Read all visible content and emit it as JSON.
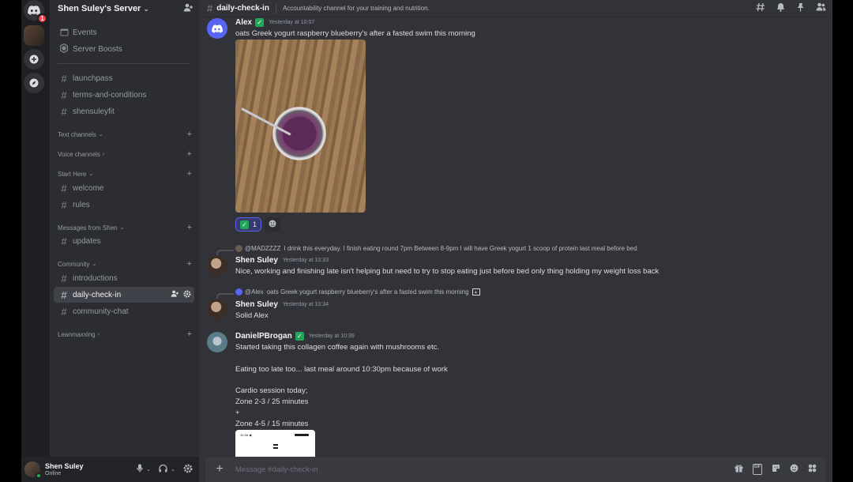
{
  "server": {
    "name": "Shen Suley's Server",
    "home_badge": "1"
  },
  "sidebar": {
    "top_items": [
      {
        "label": "Events",
        "icon": "calendar-icon"
      },
      {
        "label": "Server Boosts",
        "icon": "boost-icon"
      }
    ],
    "pinned_channels": [
      "launchpass",
      "terms-and-conditions",
      "shensuleyfit"
    ],
    "categories": {
      "text": "Text channels",
      "voice": "Voice channels",
      "start_here": "Start Here",
      "messages_from_shen": "Messages from Shen",
      "community": "Community",
      "leanmaxxing": "Leanmaxxing"
    },
    "start_here_channels": [
      "welcome",
      "rules"
    ],
    "shen_channels": [
      "updates"
    ],
    "community_channels": [
      "introductions",
      "daily-check-in",
      "community-chat"
    ],
    "active_channel": "daily-check-in"
  },
  "user": {
    "name": "Shen Suley",
    "status": "Online"
  },
  "channel": {
    "name": "daily-check-in",
    "topic": "Accountability channel for your training and nutrition.",
    "composer_placeholder": "Message #daily-check-in"
  },
  "messages": [
    {
      "author": "Alex",
      "time": "Yesterday at 10:07",
      "text": "oats Greek yogurt raspberry blueberry's after a fasted swim this morning",
      "reaction_count": "1"
    },
    {
      "reply_to": "@MADZZZZ",
      "reply_text": "I drink this everyday.   I finish eating round 7pm  Between 8-9pm I will have Greek yogurt 1 scoop of protein last meal before bed",
      "author": "Shen Suley",
      "time": "Yesterday at 10:33",
      "text": "Nice, working and finishing late isn't helping but need to try to stop eating just before bed only thing holding my weight loss back"
    },
    {
      "reply_to": "@Alex",
      "reply_text": "oats Greek yogurt raspberry blueberry's after a fasted swim this morning",
      "author": "Shen Suley",
      "time": "Yesterday at 10:34",
      "text": "Solid Alex"
    },
    {
      "author": "DanielPBrogan",
      "time": "Yesterday at 10:39",
      "lines": [
        "Started taking this collagen coffee again with mushrooms etc.",
        "Eating too late too... last meal around 10:30pm because of work",
        "Cardio session today;",
        "Zone 2-3 / 25 minutes",
        "+",
        "Zone 4-5 / 15 minutes"
      ],
      "screenshot_time": "10:36 ◀"
    }
  ]
}
